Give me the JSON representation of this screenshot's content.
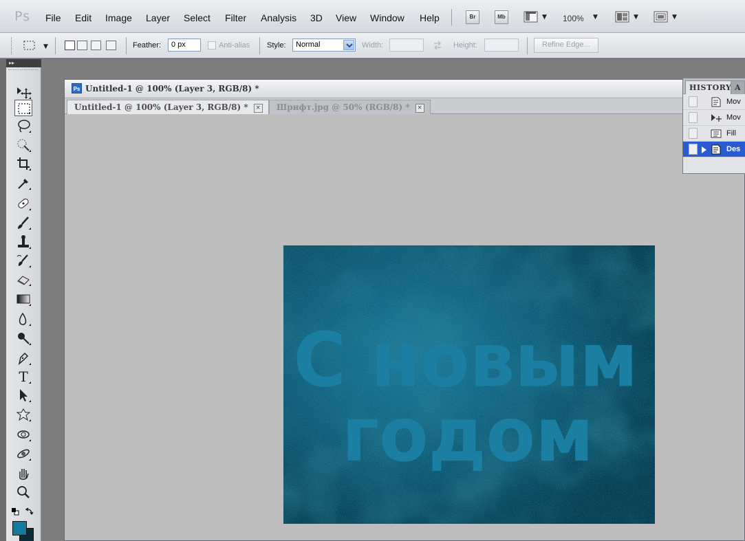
{
  "app": {
    "logo": "Ps"
  },
  "menubar": {
    "items": [
      "File",
      "Edit",
      "Image",
      "Layer",
      "Select",
      "Filter",
      "Analysis",
      "3D",
      "View",
      "Window",
      "Help"
    ],
    "bridge_label": "Br",
    "minibridge_label": "Mb",
    "zoom": "100%"
  },
  "options": {
    "feather_label": "Feather:",
    "feather_value": "0 px",
    "antialias_label": "Anti-alias",
    "style_label": "Style:",
    "style_value": "Normal",
    "width_label": "Width:",
    "height_label": "Height:",
    "refine_edge_label": "Refine Edge..."
  },
  "tools": {
    "items": [
      "move",
      "rectangular-marquee",
      "lasso",
      "quick-selection",
      "crop",
      "eyedropper",
      "spot-healing-brush",
      "brush",
      "clone-stamp",
      "history-brush",
      "eraser",
      "gradient",
      "blur",
      "dodge",
      "pen",
      "type",
      "path-selection",
      "custom-shape",
      "3d-rotate",
      "3d-orbit",
      "hand",
      "zoom"
    ],
    "active": "rectangular-marquee",
    "type_tool_glyph": "T",
    "foreground_color": "#137aa0",
    "background_color": "#0c2c3a"
  },
  "document": {
    "ps_badge": "Ps",
    "window_title": "Untitled-1 @ 100% (Layer 3, RGB/8) *",
    "tabs": [
      {
        "label": "Untitled-1 @ 100% (Layer 3, RGB/8) *",
        "active": true
      },
      {
        "label": "Шрифт.jpg @ 50% (RGB/8) *",
        "active": false
      }
    ],
    "canvas_text_line1": "С новым",
    "canvas_text_line2": "годом",
    "canvas_colors": {
      "base": "#0d5c78",
      "text": "#1b7ea3"
    }
  },
  "history": {
    "tabs": [
      "HISTORY",
      "A"
    ],
    "rows": [
      {
        "label": "Mov",
        "icon": "history-state-icon",
        "selected": false
      },
      {
        "label": "Mov",
        "icon": "move-icon",
        "selected": false
      },
      {
        "label": "Fill",
        "icon": "fill-icon",
        "selected": false
      },
      {
        "label": "Des",
        "icon": "history-state-icon",
        "selected": true
      }
    ]
  },
  "close_glyph": "×"
}
